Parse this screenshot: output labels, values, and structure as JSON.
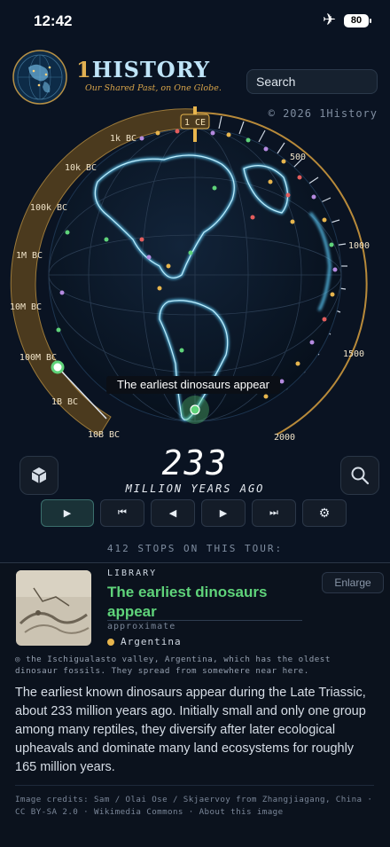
{
  "status_bar": {
    "time": "12:42",
    "battery": "80"
  },
  "header": {
    "brand_one": "1",
    "brand_rest": "HISTORY",
    "tagline": "Our Shared Past, on One Globe.",
    "search_label": "Search",
    "copyright": "© 2026 1History"
  },
  "timeline": {
    "left_labels": [
      "1k BC",
      "10k BC",
      "100k BC",
      "1M BC",
      "10M BC",
      "100M BC",
      "1B BC",
      "10B BC"
    ],
    "center_label": "1 CE",
    "right_labels": [
      "500",
      "1000",
      "1500",
      "2000"
    ]
  },
  "globe": {
    "tooltip": "The earliest dinosaurs appear"
  },
  "counter": {
    "value": "233",
    "unit": "MILLION YEARS AGO"
  },
  "tour": {
    "stops_label": "412 STOPS ON THIS TOUR:"
  },
  "card": {
    "category": "LIBRARY",
    "title": "The earliest dinosaurs appear",
    "precision": "approximate",
    "place": "Argentina",
    "enlarge_label": "Enlarge",
    "caption": "◎ the Ischigualasto valley, Argentina, which has the oldest dinosaur fossils. They spread from somewhere near here.",
    "body": "The earliest known dinosaurs appear during the Late Triassic, about 233 million years ago. Initially small and only one group among many reptiles, they diversify after later ecological upheavals and dominate many land ecosystems for roughly 165 million years.",
    "credits": "Image credits: Sam / Olai Ose / Skjaervoy from Zhangjiagang, China · CC BY-SA 2.0 · Wikimedia Commons · About this image"
  },
  "colors": {
    "accent_green": "#5fd37a",
    "gold": "#d8a44a",
    "glow_cyan": "#5fd0ff"
  }
}
